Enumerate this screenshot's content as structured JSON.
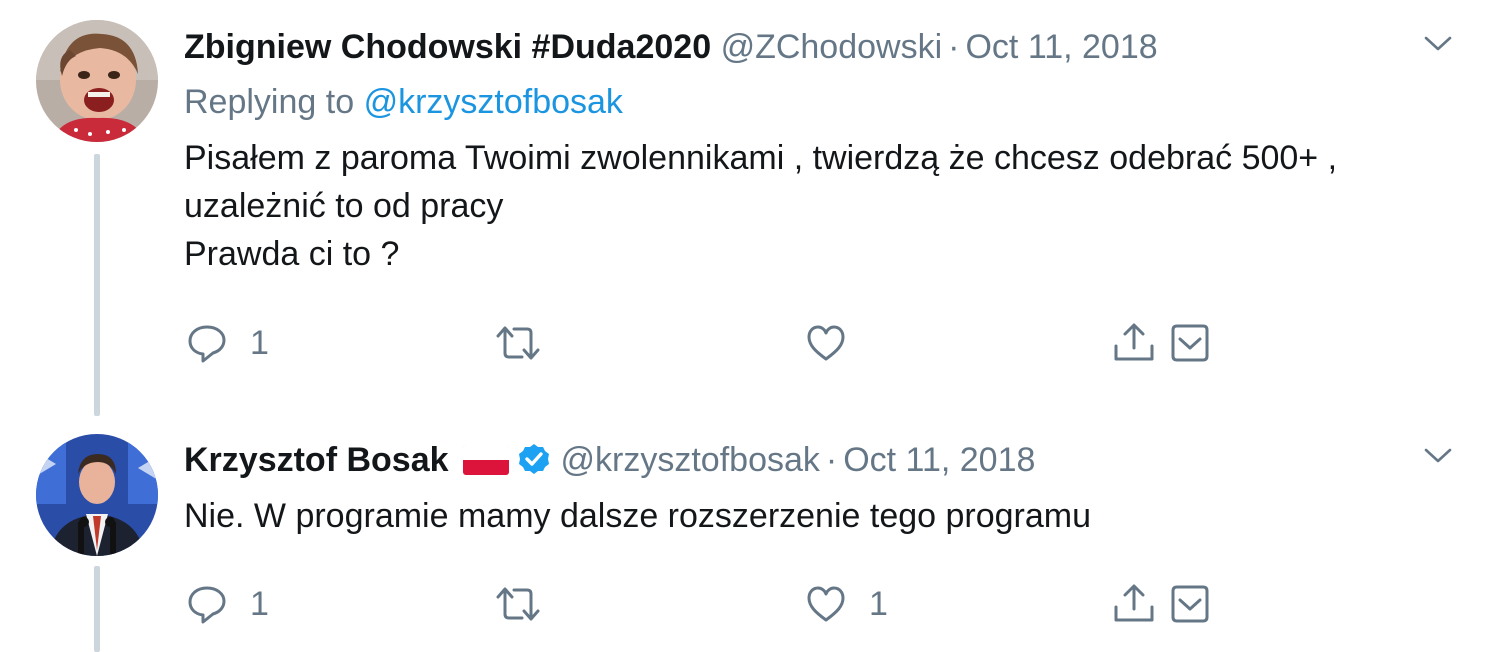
{
  "tweets": [
    {
      "author": "Zbigniew Chodowski #Duda2020",
      "handle": "@ZChodowski",
      "separator": "·",
      "date": "Oct 11, 2018",
      "replying_label": "Replying to",
      "replying_to": "@krzysztofbosak",
      "text": "Pisałem z paroma Twoimi zwolennikami , twierdzą że chcesz odebrać 500+ ,\nuzależnić to od pracy\nPrawda ci to ?",
      "reply_count": "1",
      "retweet_count": "",
      "like_count": ""
    },
    {
      "author": "Krzysztof Bosak",
      "handle": "@krzysztofbosak",
      "separator": "·",
      "date": "Oct 11, 2018",
      "verified": true,
      "flag": "poland-flag",
      "text": "Nie. W programie mamy dalsze rozszerzenie tego programu",
      "reply_count": "1",
      "retweet_count": "",
      "like_count": "1"
    }
  ],
  "colors": {
    "text": "#14171a",
    "secondary": "#657786",
    "link": "#1b95e0",
    "thread_line": "#ccd6dd",
    "verified": "#1da1f2"
  },
  "icons": [
    "reply-icon",
    "retweet-icon",
    "like-icon",
    "share-icon",
    "dm-icon",
    "chevron-down-icon"
  ]
}
